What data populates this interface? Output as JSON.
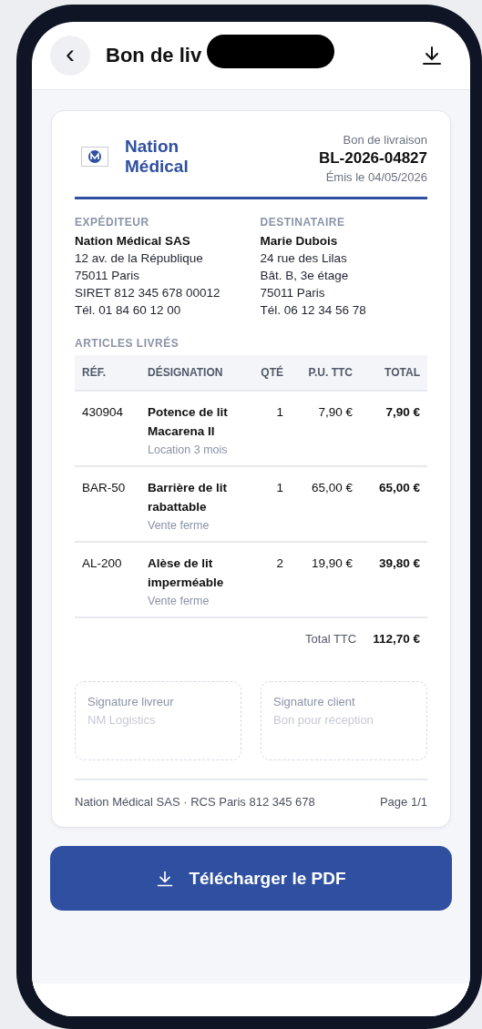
{
  "header": {
    "back_label": "‹",
    "title": "Bon de liv"
  },
  "document": {
    "brand": {
      "line1": "Nation",
      "line2": "Médical"
    },
    "doc_type": "Bon de livraison",
    "number": "BL-2026-04827",
    "issued": "Émis le 04/05/2026",
    "parties": [
      {
        "heading": "EXPÉDITEUR",
        "name": "Nation Médical SAS",
        "lines": [
          "12 av. de la République",
          "75011 Paris",
          "SIRET 812 345 678 00012",
          "Tél. 01 84 60 12 00"
        ]
      },
      {
        "heading": "DESTINATAIRE",
        "name": "Marie Dubois",
        "lines": [
          "24 rue des Lilas",
          "Bât. B, 3e étage",
          "75011 Paris",
          "Tél. 06 12 34 56 78"
        ]
      }
    ],
    "items_heading": "ARTICLES LIVRÉS",
    "table": {
      "columns": [
        "RÉF.",
        "DÉSIGNATION",
        "QTÉ",
        "P.U. TTC",
        "TOTAL"
      ],
      "rows": [
        {
          "ref": "430904",
          "name": "Potence de lit Macarena II",
          "note": "Location 3 mois",
          "qty": "1",
          "unit": "7,90 €",
          "total": "7,90 €"
        },
        {
          "ref": "BAR-50",
          "name": "Barrière de lit rabattable",
          "note": "Vente ferme",
          "qty": "1",
          "unit": "65,00 €",
          "total": "65,00 €"
        },
        {
          "ref": "AL-200",
          "name": "Alèse de lit imperméable",
          "note": "Vente ferme",
          "qty": "2",
          "unit": "19,90 €",
          "total": "39,80 €"
        }
      ],
      "total_label": "Total TTC",
      "total_value": "112,70 €"
    },
    "signatures": [
      {
        "title": "Signature livreur",
        "hint": "NM Logistics"
      },
      {
        "title": "Signature client",
        "hint": "Bon pour réception"
      }
    ],
    "footer": {
      "legal": "Nation Médical SAS · RCS Paris 812 345 678",
      "page": "Page 1/1"
    }
  },
  "download_button": "Télécharger le PDF"
}
